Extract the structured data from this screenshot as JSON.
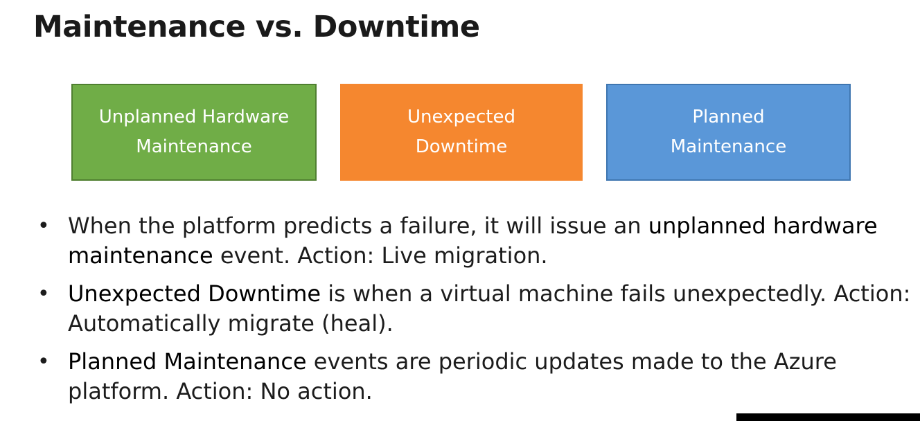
{
  "slide": {
    "title": "Maintenance vs. Downtime"
  },
  "boxes": [
    {
      "label": "Unplanned Hardware\nMaintenance",
      "color": "#70ad47"
    },
    {
      "label": "Unexpected\nDowntime",
      "color": "#f5872f"
    },
    {
      "label": "Planned\nMaintenance",
      "color": "#5a97d8"
    }
  ],
  "bullets": [
    {
      "bullet": "•",
      "pre": "When the platform predicts a failure, it will issue an ",
      "emphasis": "unplanned hardware maintenance",
      "post": " event. Action: Live migration."
    },
    {
      "bullet": "•",
      "pre": "",
      "emphasis": "Unexpected Downtime",
      "post": " is when a virtual machine fails unexpectedly. Action: Automatically migrate (heal)."
    },
    {
      "bullet": "•",
      "pre": "",
      "emphasis": "Planned Maintenance",
      "post": " events are periodic updates made to the Azure platform. Action: No action."
    }
  ]
}
